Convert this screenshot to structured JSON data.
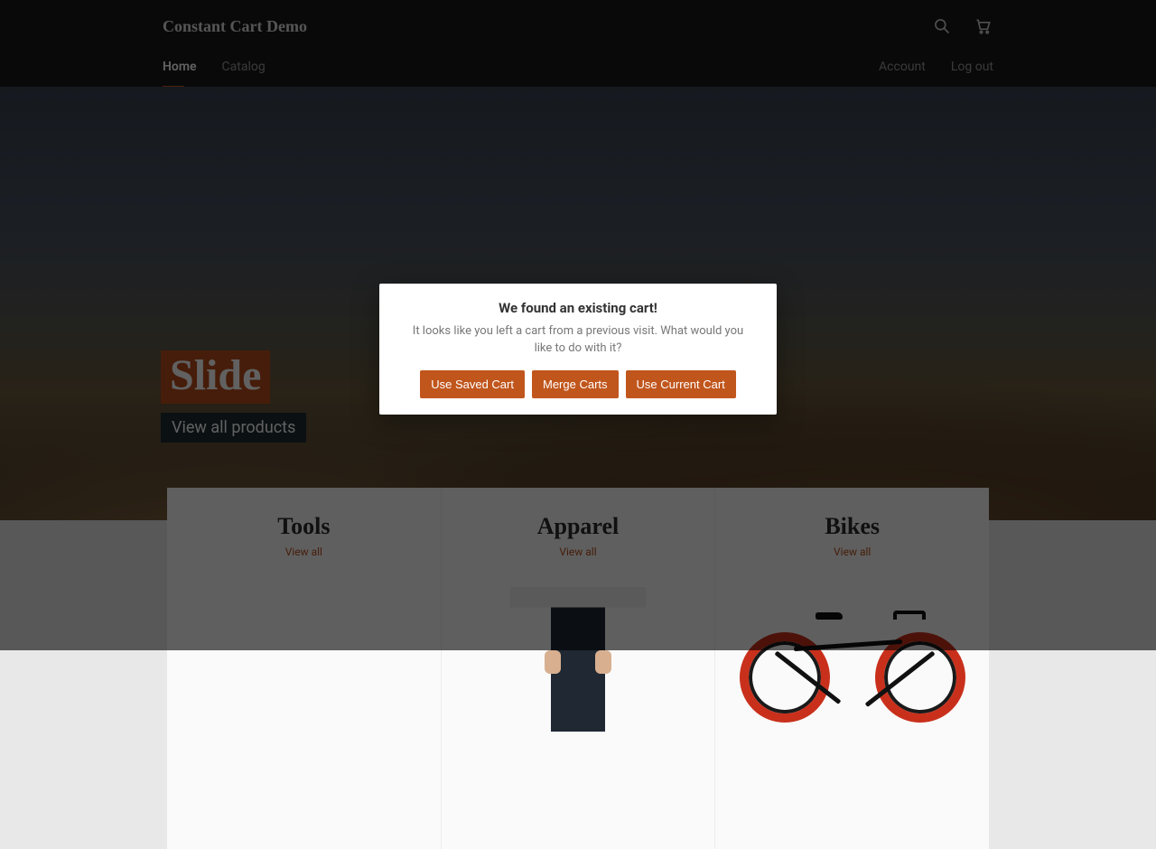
{
  "brand": "Constant Cart Demo",
  "nav": {
    "home": "Home",
    "catalog": "Catalog",
    "account": "Account",
    "logout": "Log out"
  },
  "hero": {
    "title": "Slide",
    "subtitle": "View all products"
  },
  "collections": [
    {
      "title": "Tools",
      "view_all": "View all"
    },
    {
      "title": "Apparel",
      "view_all": "View all"
    },
    {
      "title": "Bikes",
      "view_all": "View all"
    }
  ],
  "modal": {
    "title": "We found an existing cart!",
    "body": "It looks like you left a cart from a previous visit. What would you like to do with it?",
    "use_saved": "Use Saved Cart",
    "merge": "Merge Carts",
    "use_current": "Use Current Cart"
  },
  "colors": {
    "accent": "#c1561d"
  }
}
